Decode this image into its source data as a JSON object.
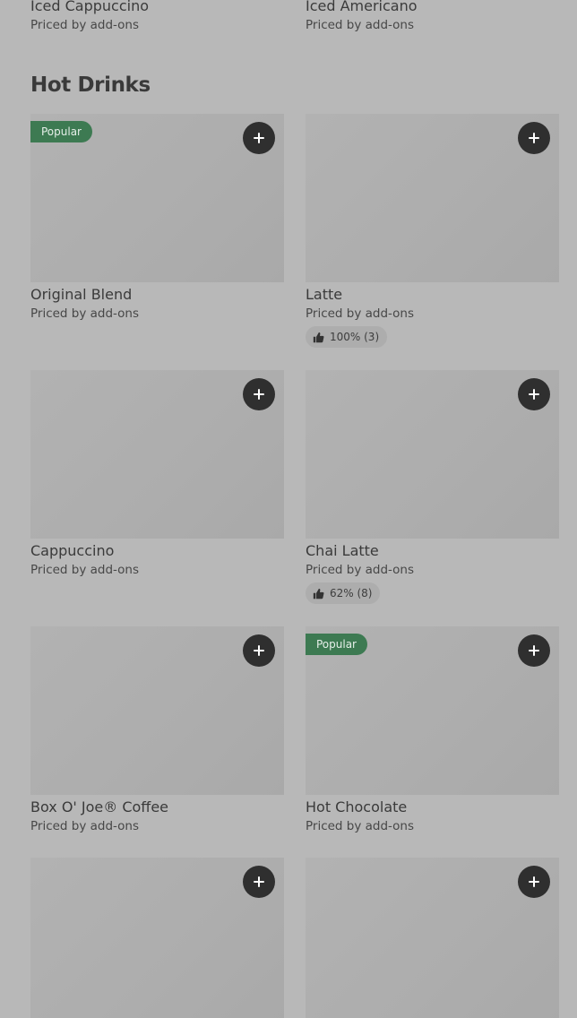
{
  "previous_section": {
    "items": [
      {
        "name": "Iced Cappuccino",
        "price": "Priced by add-ons"
      },
      {
        "name": "Iced Americano",
        "price": "Priced by add-ons"
      }
    ]
  },
  "section": {
    "title": "Hot Drinks",
    "items": [
      {
        "name": "Original Blend",
        "price": "Priced by add-ons",
        "badge": "Popular",
        "add_icon": "plus-icon"
      },
      {
        "name": "Latte",
        "price": "Priced by add-ons",
        "rating": "100% (3)",
        "rating_icon": "thumbs-up-icon",
        "add_icon": "plus-icon"
      },
      {
        "name": "Cappuccino",
        "price": "Priced by add-ons",
        "add_icon": "plus-icon"
      },
      {
        "name": "Chai Latte",
        "price": "Priced by add-ons",
        "rating": "62% (8)",
        "rating_icon": "thumbs-up-icon",
        "add_icon": "plus-icon"
      },
      {
        "name": "Box O' Joe® Coffee",
        "price": "Priced by add-ons",
        "add_icon": "plus-icon"
      },
      {
        "name": "Hot Chocolate",
        "price": "Priced by add-ons",
        "badge": "Popular",
        "add_icon": "plus-icon"
      },
      {
        "name": "",
        "price": "",
        "add_icon": "plus-icon"
      },
      {
        "name": "",
        "price": "",
        "add_icon": "plus-icon"
      }
    ]
  },
  "colors": {
    "page_background": "#b8b8b8",
    "card_image": "#adadad",
    "popular_badge": "#3d7a52",
    "add_button": "#2f2f2f"
  }
}
